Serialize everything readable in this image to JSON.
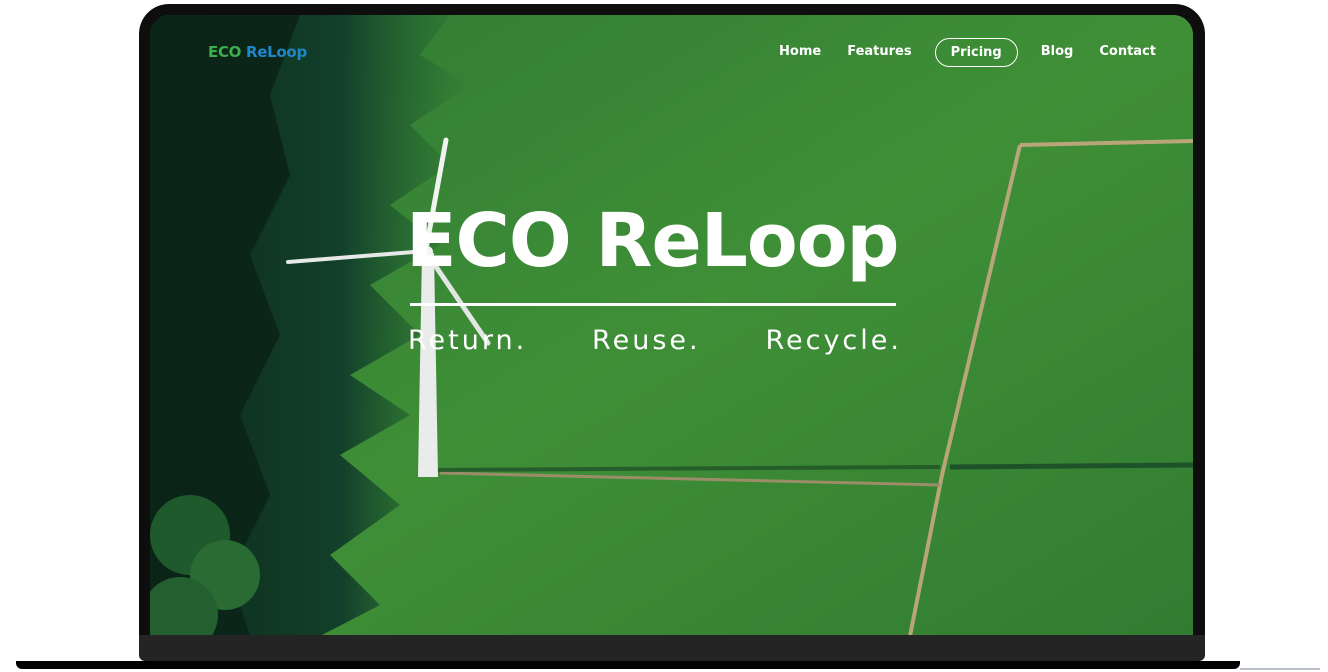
{
  "brand": {
    "logo_word1": "ECO",
    "logo_word2": "ReLoop",
    "colors": {
      "eco_green": "#3fae4d",
      "reloop_blue": "#1f87c9"
    }
  },
  "nav": {
    "items": [
      {
        "label": "Home"
      },
      {
        "label": "Features"
      },
      {
        "label": "Pricing",
        "active": true
      },
      {
        "label": "Blog"
      },
      {
        "label": "Contact"
      }
    ]
  },
  "hero": {
    "title": "ECO ReLoop",
    "tagline": [
      "Return.",
      "Reuse.",
      "Recycle."
    ],
    "background": "aerial green field with wind turbine"
  }
}
